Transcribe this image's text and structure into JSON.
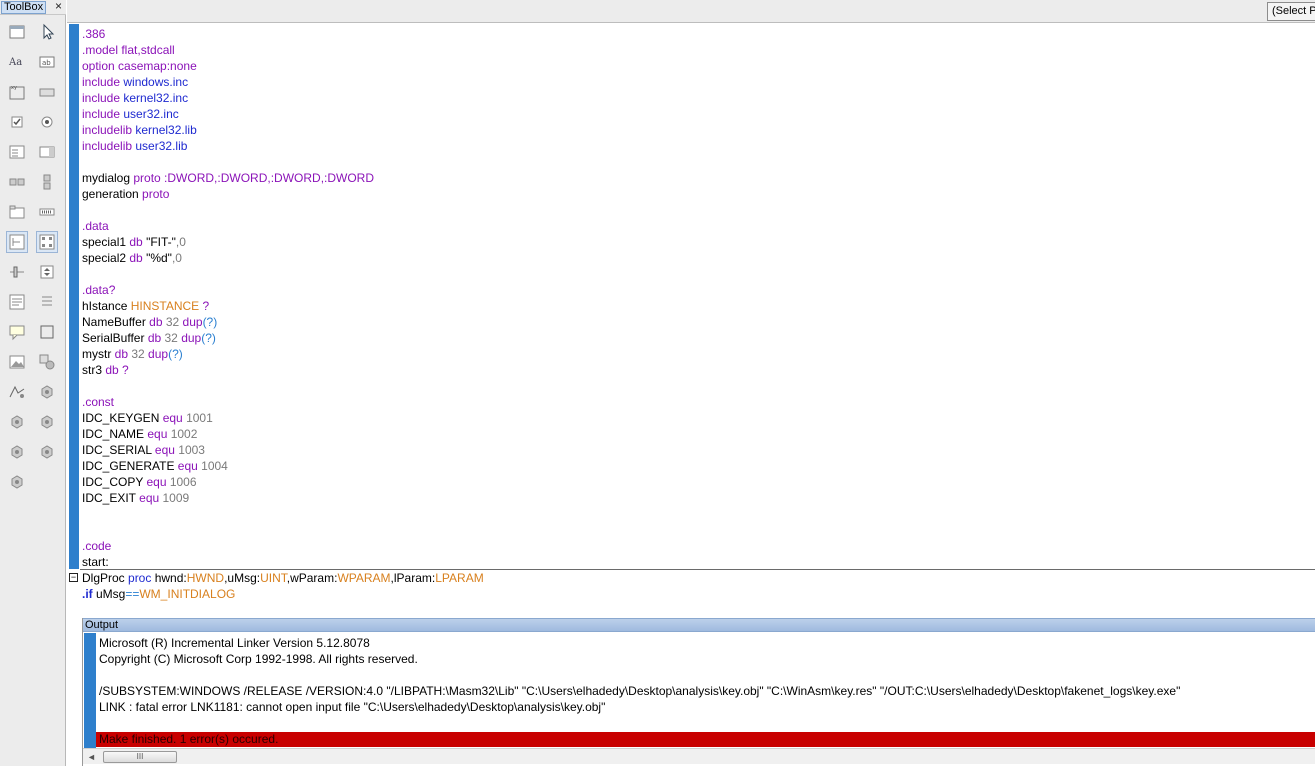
{
  "toolbox": {
    "title": "ToolBox",
    "close": "×",
    "tools": [
      {
        "name": "dialog-tool-icon"
      },
      {
        "name": "pointer-tool-icon"
      },
      {
        "name": "static-text-tool-icon"
      },
      {
        "name": "edit-box-tool-icon"
      },
      {
        "name": "group-box-tool-icon"
      },
      {
        "name": "button-tool-icon"
      },
      {
        "name": "checkbox-tool-icon"
      },
      {
        "name": "radio-button-tool-icon"
      },
      {
        "name": "combo-box-tool-icon"
      },
      {
        "name": "list-box-tool-icon"
      },
      {
        "name": "horizontal-scroll-tool-icon"
      },
      {
        "name": "vertical-scroll-tool-icon"
      },
      {
        "name": "tab-control-tool-icon"
      },
      {
        "name": "progress-bar-tool-icon"
      },
      {
        "name": "treeview-tool-icon"
      },
      {
        "name": "listview-tool-icon"
      },
      {
        "name": "trackbar-tool-icon"
      },
      {
        "name": "updown-tool-icon"
      },
      {
        "name": "richedit-tool-icon"
      },
      {
        "name": "image-list-tool-icon"
      },
      {
        "name": "tool-tip-tool-icon"
      },
      {
        "name": "rectangle-tool-icon"
      },
      {
        "name": "image-tool-icon"
      },
      {
        "name": "shape-tool-icon"
      },
      {
        "name": "animate-tool-icon"
      },
      {
        "name": "custom-control-icon"
      },
      {
        "name": "custom-control-icon"
      },
      {
        "name": "custom-control-icon"
      },
      {
        "name": "custom-control-icon"
      },
      {
        "name": "custom-control-icon"
      },
      {
        "name": "custom-control-icon"
      }
    ]
  },
  "topbar": {
    "select_label": "(Select Pr"
  },
  "editor": {
    "lines": [
      [
        {
          "t": ".386",
          "c": "dir"
        }
      ],
      [
        {
          "t": ".model flat,stdcall",
          "c": "dir"
        }
      ],
      [
        {
          "t": "option casemap:none",
          "c": "dir"
        }
      ],
      [
        {
          "t": "include ",
          "c": "dir"
        },
        {
          "t": "windows.inc",
          "c": "kw"
        }
      ],
      [
        {
          "t": "include ",
          "c": "dir"
        },
        {
          "t": "kernel32.inc",
          "c": "kw"
        }
      ],
      [
        {
          "t": "include ",
          "c": "dir"
        },
        {
          "t": "user32.inc",
          "c": "kw"
        }
      ],
      [
        {
          "t": "includelib ",
          "c": "dir"
        },
        {
          "t": "kernel32.lib",
          "c": "kw"
        }
      ],
      [
        {
          "t": "includelib ",
          "c": "dir"
        },
        {
          "t": "user32.lib",
          "c": "kw"
        }
      ],
      [],
      [
        {
          "t": "mydialog ",
          "c": "str"
        },
        {
          "t": "proto ",
          "c": "dir"
        },
        {
          "t": ":DWORD,:DWORD,:DWORD,:DWORD",
          "c": "dir"
        }
      ],
      [
        {
          "t": "generation ",
          "c": "str"
        },
        {
          "t": "proto",
          "c": "dir"
        }
      ],
      [],
      [
        {
          "t": ".data",
          "c": "dir"
        }
      ],
      [
        {
          "t": "special1 ",
          "c": "str"
        },
        {
          "t": "db ",
          "c": "dir"
        },
        {
          "t": "\"FIT-\"",
          "c": "str"
        },
        {
          "t": ",0",
          "c": "num"
        }
      ],
      [
        {
          "t": "special2 ",
          "c": "str"
        },
        {
          "t": "db ",
          "c": "dir"
        },
        {
          "t": "\"%d\"",
          "c": "str"
        },
        {
          "t": ",0",
          "c": "num"
        }
      ],
      [],
      [
        {
          "t": ".data?",
          "c": "dir"
        }
      ],
      [
        {
          "t": "hIstance ",
          "c": "str"
        },
        {
          "t": "HINSTANCE ",
          "c": "typ"
        },
        {
          "t": "?",
          "c": "dir"
        }
      ],
      [
        {
          "t": "NameBuffer ",
          "c": "str"
        },
        {
          "t": "db ",
          "c": "dir"
        },
        {
          "t": "32 ",
          "c": "num"
        },
        {
          "t": "dup",
          "c": "dir"
        },
        {
          "t": "(?)",
          "c": "sym"
        }
      ],
      [
        {
          "t": "SerialBuffer ",
          "c": "str"
        },
        {
          "t": "db ",
          "c": "dir"
        },
        {
          "t": "32 ",
          "c": "num"
        },
        {
          "t": "dup",
          "c": "dir"
        },
        {
          "t": "(?)",
          "c": "sym"
        }
      ],
      [
        {
          "t": "mystr ",
          "c": "str"
        },
        {
          "t": "db ",
          "c": "dir"
        },
        {
          "t": "32 ",
          "c": "num"
        },
        {
          "t": "dup",
          "c": "dir"
        },
        {
          "t": "(?)",
          "c": "sym"
        }
      ],
      [
        {
          "t": "str3 ",
          "c": "str"
        },
        {
          "t": "db ?",
          "c": "dir"
        }
      ],
      [],
      [
        {
          "t": ".const",
          "c": "dir"
        }
      ],
      [
        {
          "t": "IDC_KEYGEN ",
          "c": "str"
        },
        {
          "t": "equ ",
          "c": "dir"
        },
        {
          "t": "1001",
          "c": "num"
        }
      ],
      [
        {
          "t": "IDC_NAME ",
          "c": "str"
        },
        {
          "t": "equ ",
          "c": "dir"
        },
        {
          "t": "1002",
          "c": "num"
        }
      ],
      [
        {
          "t": "IDC_SERIAL ",
          "c": "str"
        },
        {
          "t": "equ ",
          "c": "dir"
        },
        {
          "t": "1003",
          "c": "num"
        }
      ],
      [
        {
          "t": "IDC_GENERATE ",
          "c": "str"
        },
        {
          "t": "equ ",
          "c": "dir"
        },
        {
          "t": "1004",
          "c": "num"
        }
      ],
      [
        {
          "t": "IDC_COPY ",
          "c": "str"
        },
        {
          "t": "equ ",
          "c": "dir"
        },
        {
          "t": "1006",
          "c": "num"
        }
      ],
      [
        {
          "t": "IDC_EXIT ",
          "c": "str"
        },
        {
          "t": "equ ",
          "c": "dir"
        },
        {
          "t": "1009",
          "c": "num"
        }
      ],
      [],
      [],
      [
        {
          "t": ".code",
          "c": "dir"
        }
      ],
      [
        {
          "t": "start:",
          "c": "str"
        }
      ],
      [
        {
          "t": "DlgProc ",
          "c": "str"
        },
        {
          "t": "proc ",
          "c": "kw"
        },
        {
          "t": "hwnd:",
          "c": "str"
        },
        {
          "t": "HWND",
          "c": "typ"
        },
        {
          "t": ",uMsg:",
          "c": "str"
        },
        {
          "t": "UINT",
          "c": "typ"
        },
        {
          "t": ",wParam:",
          "c": "str"
        },
        {
          "t": "WPARAM",
          "c": "typ"
        },
        {
          "t": ",lParam:",
          "c": "str"
        },
        {
          "t": "LPARAM",
          "c": "typ"
        }
      ],
      [
        {
          "t": ".if ",
          "c": "bold"
        },
        {
          "t": "uMsg",
          "c": "str"
        },
        {
          "t": "==",
          "c": "sym"
        },
        {
          "t": "WM_INITDIALOG",
          "c": "typ"
        }
      ]
    ]
  },
  "output": {
    "title": "Output",
    "lines": [
      "Microsoft (R) Incremental Linker Version 5.12.8078",
      "Copyright (C) Microsoft Corp 1992-1998. All rights reserved.",
      "",
      "/SUBSYSTEM:WINDOWS /RELEASE /VERSION:4.0 \"/LIBPATH:\\Masm32\\Lib\" \"C:\\Users\\elhadedy\\Desktop\\analysis\\key.obj\" \"C:\\WinAsm\\key.res\" \"/OUT:C:\\Users\\elhadedy\\Desktop\\fakenet_logs\\key.exe\"",
      "LINK : fatal error LNK1181: cannot open input file \"C:\\Users\\elhadedy\\Desktop\\analysis\\key.obj\""
    ],
    "error_line": "Make finished. 1 error(s) occured.",
    "scroll_left": "◄",
    "scroll_thumb": "III"
  },
  "colors": {
    "gutter": "#2e7fcc",
    "directive": "#8b13b8",
    "keyword": "#1f2ad0",
    "type": "#d8801e",
    "number": "#7a7a7a",
    "error_bg": "#c80000"
  }
}
